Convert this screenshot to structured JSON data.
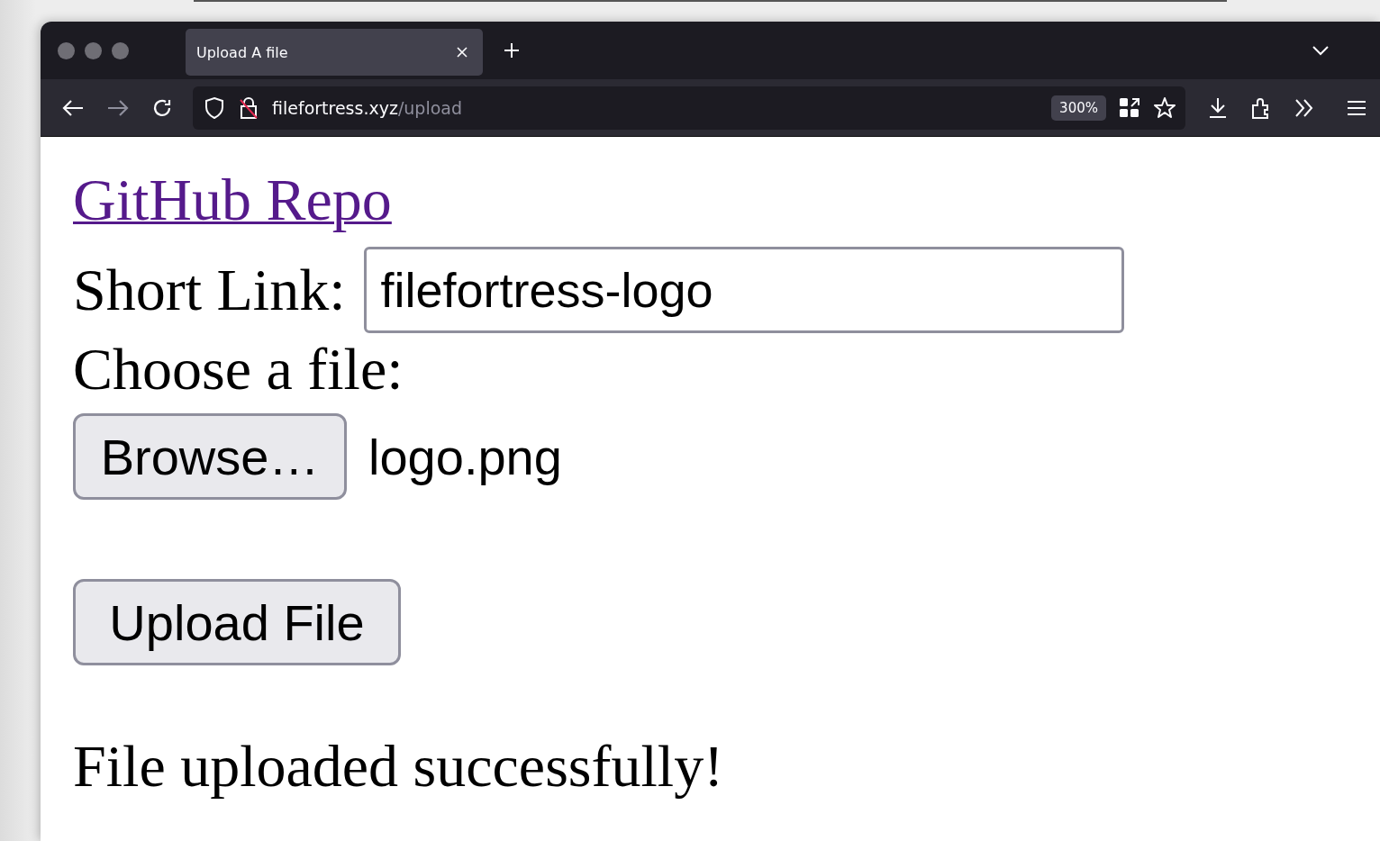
{
  "tabs": [
    {
      "title": "Upload A file",
      "selected": true
    }
  ],
  "address_bar": {
    "domain": "filefortress.xyz",
    "path": "/upload",
    "zoom": "300%"
  },
  "page": {
    "link": "GitHub Repo",
    "short_link": {
      "label": "Short Link:",
      "value": "filefortress-logo"
    },
    "file": {
      "label": "Choose a file:",
      "button": "Browse…",
      "filename": "logo.png"
    },
    "submit": "Upload File",
    "message": "File uploaded successfully!"
  }
}
